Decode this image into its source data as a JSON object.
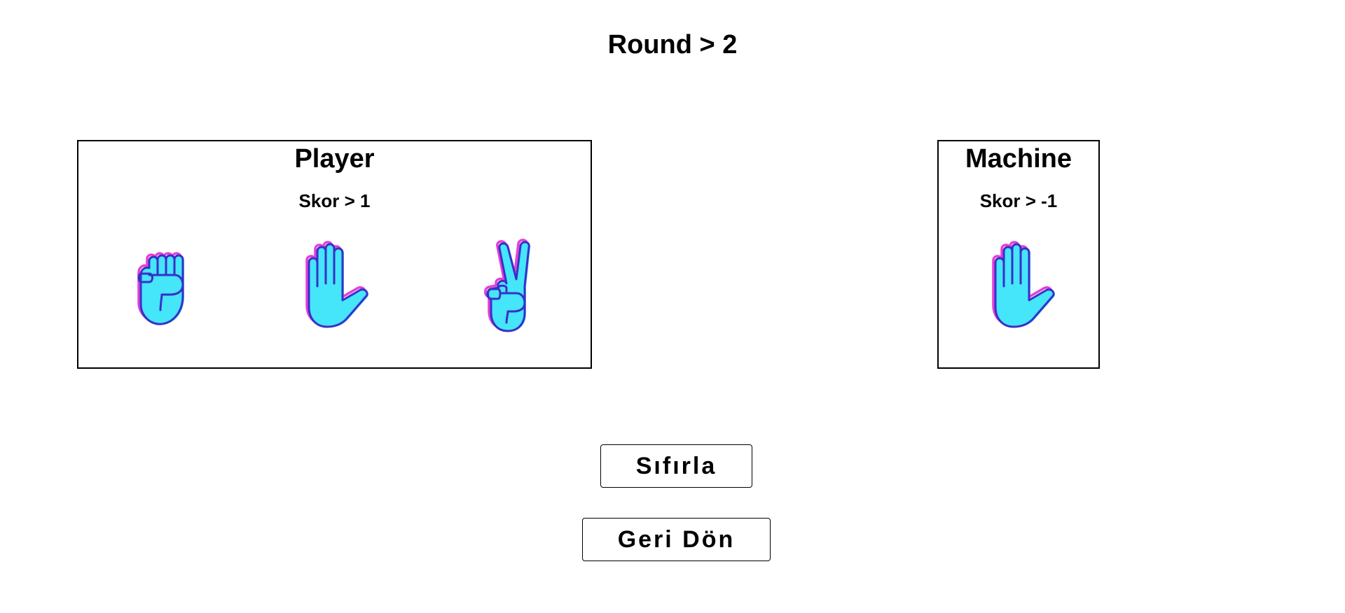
{
  "round": {
    "label": "Round > 2"
  },
  "player": {
    "title": "Player",
    "score_label": "Skor > 1",
    "choices": [
      {
        "icon": "rock-hand-icon"
      },
      {
        "icon": "paper-hand-icon"
      },
      {
        "icon": "scissors-hand-icon"
      }
    ]
  },
  "machine": {
    "title": "Machine",
    "score_label": "Skor > -1",
    "choice": {
      "icon": "paper-hand-icon"
    }
  },
  "buttons": {
    "reset_label": "Sıfırla",
    "back_label": "Geri Dön"
  },
  "colors": {
    "hand_fill": "#45e5fa",
    "hand_outline": "#3a2fc8",
    "hand_shadow": "#e63fd6"
  }
}
